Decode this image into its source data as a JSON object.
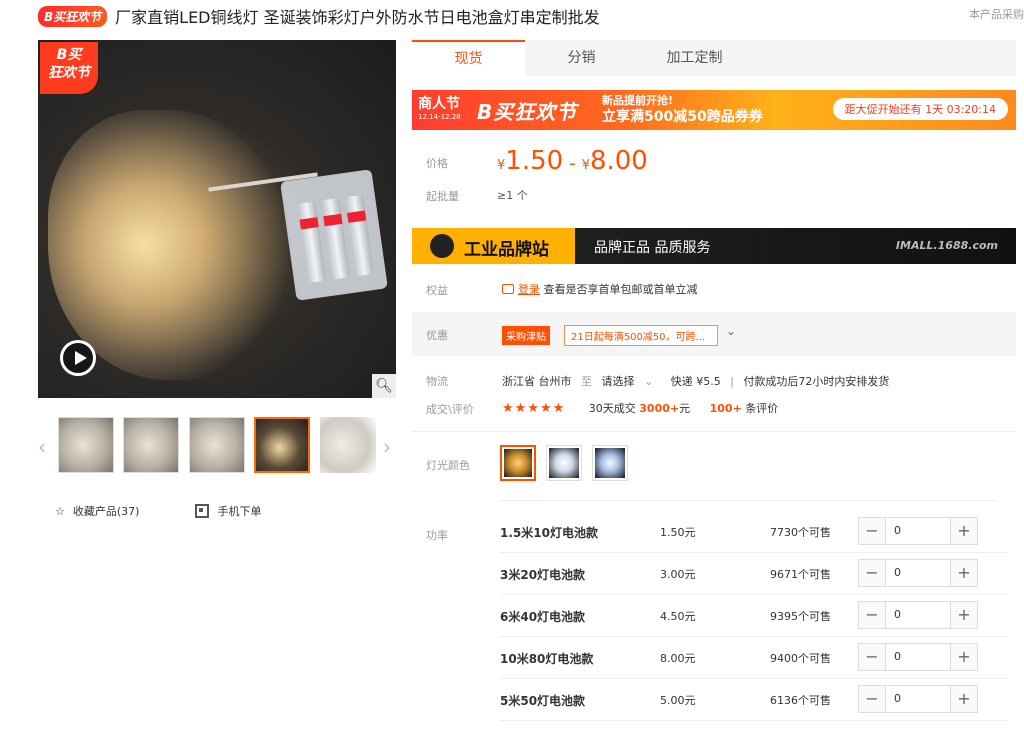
{
  "header": {
    "badge": "B买狂欢节",
    "title": "厂家直销LED铜线灯 圣诞装饰彩灯户外防水节日电池盒灯串定制批发",
    "right_text": "本产品采购"
  },
  "gallery": {
    "main_badge_line1": "B买",
    "main_badge_line2": "狂欢节",
    "zoom_icon": "magnifier-icon",
    "play_icon": "play-icon",
    "thumbnail_count": 5,
    "active_thumbnail_index": 3
  },
  "actions": {
    "favorite_label": "收藏产品(37)",
    "mobile_order_label": "手机下单"
  },
  "tabs": [
    "现货",
    "分销",
    "加工定制"
  ],
  "banner": {
    "event_name": "商人节",
    "event_dates": "12.14-12.28",
    "brand": "B买狂欢节",
    "promo_line1": "新品提前开抢!",
    "promo_line2": "立享满500减50跨品券券",
    "countdown": "距大促开始还有 1天 03:20:14"
  },
  "price": {
    "label": "价格",
    "currency": "¥",
    "min": "1.50",
    "dash": "-",
    "max": "8.00",
    "moq_label": "起批量",
    "moq_value": "≥1 个"
  },
  "imall": {
    "title": "工业品牌站",
    "subtitle": "品牌正品 品质服务",
    "url": "IMALL.1688.com"
  },
  "rights": {
    "label": "权益",
    "login_text": "登录",
    "desc": "查看是否享首单包邮或首单立减"
  },
  "youhui": {
    "label": "优惠",
    "tag": "采购津贴",
    "coupon": "21日起每满500减50，可跨...",
    "chevron": "⌄"
  },
  "logistics": {
    "label": "物流",
    "from": "浙江省 台州市",
    "to_word": "至",
    "select": "请选择",
    "chevron": "⌄",
    "express": "快递 ¥5.5",
    "delivery": "付款成功后72小时内安排发货"
  },
  "evaluation": {
    "label": "成交\\评价",
    "stars": "★★★★★",
    "deals_prefix": "30天成交",
    "deals_value": "3000+",
    "deals_unit": "元",
    "reviews_value": "100+",
    "reviews_suffix": "条评价"
  },
  "colors": {
    "label": "灯光颜色",
    "options": [
      {
        "name": "warm-white",
        "color": "#f2b64a"
      },
      {
        "name": "cool-white",
        "color": "#cfd9e8"
      },
      {
        "name": "blue-white",
        "color": "#a9c1e6"
      }
    ],
    "selected_index": 0
  },
  "skus": {
    "label": "功率",
    "rows": [
      {
        "name": "1.5米10灯电池款",
        "price": "1.50元",
        "stock": "7730个可售",
        "qty": "0"
      },
      {
        "name": "3米20灯电池款",
        "price": "3.00元",
        "stock": "9671个可售",
        "qty": "0"
      },
      {
        "name": "6米40灯电池款",
        "price": "4.50元",
        "stock": "9395个可售",
        "qty": "0"
      },
      {
        "name": "10米80灯电池款",
        "price": "8.00元",
        "stock": "9400个可售",
        "qty": "0"
      },
      {
        "name": "5米50灯电池款",
        "price": "5.00元",
        "stock": "6136个可售",
        "qty": "0"
      }
    ],
    "minus": "−",
    "plus": "+"
  },
  "theme": {
    "accent": "#ff5000",
    "banner_start": "#ff3d2e",
    "imall_yellow": "#ffb000"
  }
}
